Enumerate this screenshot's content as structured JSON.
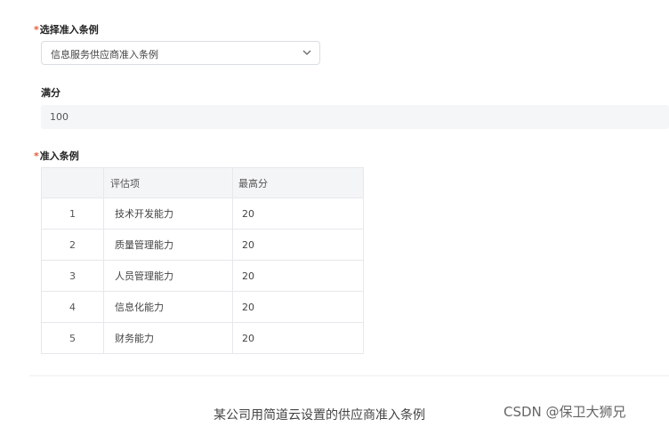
{
  "form": {
    "admission_rule": {
      "required_mark": "*",
      "label": "选择准入条例",
      "selected_value": "信息服务供应商准入条例"
    },
    "full_score": {
      "label": "满分",
      "value": "100"
    },
    "admission_criteria": {
      "required_mark": "*",
      "label": "准入条例",
      "columns": [
        "",
        "评估项",
        "最高分"
      ],
      "rows": [
        {
          "index": "1",
          "item": "技术开发能力",
          "max_score": "20"
        },
        {
          "index": "2",
          "item": "质量管理能力",
          "max_score": "20"
        },
        {
          "index": "3",
          "item": "人员管理能力",
          "max_score": "20"
        },
        {
          "index": "4",
          "item": "信息化能力",
          "max_score": "20"
        },
        {
          "index": "5",
          "item": "财务能力",
          "max_score": "20"
        }
      ]
    }
  },
  "caption": "某公司用简道云设置的供应商准入条例",
  "watermark": "CSDN @保卫大狮兄",
  "icons": {
    "select_arrow": "chevron-down-icon"
  },
  "colors": {
    "required": "#e65a3c",
    "header_bg": "#f4f5f7",
    "readonly_bg": "#f5f6f7"
  }
}
